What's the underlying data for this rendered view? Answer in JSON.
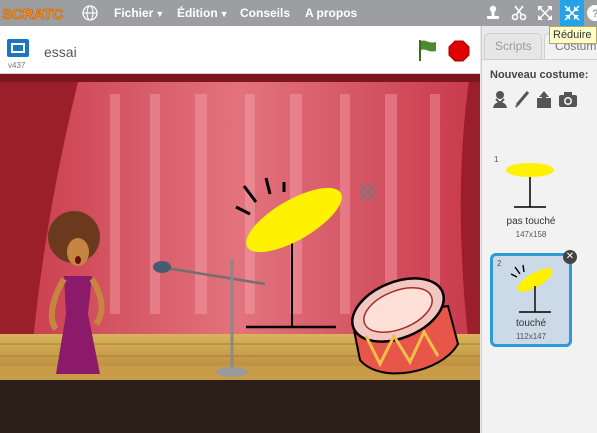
{
  "menubar": {
    "logo_text": "SCRATCH",
    "items": [
      "Fichier",
      "Édition",
      "Conseils",
      "A propos"
    ]
  },
  "tooltip": "Réduire",
  "stage": {
    "version": "v437",
    "project_title": "essai"
  },
  "tabs": {
    "scripts": "Scripts",
    "costumes": "Costumes"
  },
  "costumes_panel": {
    "new_costume_label": "Nouveau costume:",
    "costumes": [
      {
        "index": "1",
        "name": "pas touché",
        "size": "147x158",
        "selected": false
      },
      {
        "index": "2",
        "name": "touché",
        "size": "112x147",
        "selected": true
      }
    ]
  },
  "colors": {
    "menubar": "#9c9ea2",
    "accent": "#24a3e8",
    "flag": "#4c8a2f",
    "stop": "#e00000",
    "cymbal": "#fff200"
  }
}
